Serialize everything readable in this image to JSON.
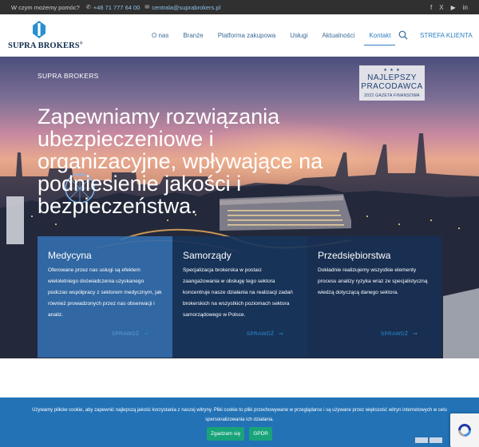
{
  "topbar": {
    "question": "W czym możemy pomóc?",
    "phone": "+48 71 777 64 00",
    "email": "centrala@suprabrokers.pl",
    "social": [
      "f",
      "X",
      "▶",
      "in"
    ]
  },
  "header": {
    "logo_text": "SUPRA BROKERS",
    "logo_reg": "®",
    "nav": [
      "O nas",
      "Branże",
      "Platforma zakupowa",
      "Usługi",
      "Aktualności",
      "Kontakt"
    ],
    "active_nav": "Kontakt",
    "strefa": "STREFA KLIENTA"
  },
  "hero": {
    "brand": "SUPRA BROKERS",
    "headline": "Zapewniamy rozwiązania ubezpieczeniowe i organizacyjne, wpływające na podniesienie jakości i bezpieczeństwa.",
    "award": {
      "line1": "NAJLEPSZY",
      "line2": "PRACODAWCA",
      "line3": "2022 GAZETA FINANSOWA"
    }
  },
  "cards": [
    {
      "title": "Medycyna",
      "text": "Oferowane przez nas usługi są efektem wieloletniego doświadczenia uzyskanego podczas współpracy z sektorem medycznym, jak również prowadzonych przez nas obserwacji i analiz.",
      "more": "SPRAWDŹ"
    },
    {
      "title": "Samorządy",
      "text": "Specjalizacja brokerska w postaci zaangażowania w obsługę tego sektora koncentruje nasze działania na realizacji zadań brokerskich na wszystkich poziomach sektora samorządowego w Polsce.",
      "more": "SPRAWDŹ"
    },
    {
      "title": "Przedsiębiorstwa",
      "text": "Dokładnie realizujemy wszystkie elementy procesu analizy ryzyka wraz ze specjalistyczną wiedzą dotyczącą danego sektora.",
      "more": "SPRAWDŹ"
    }
  ],
  "cookie": {
    "text": "Używamy plików cookie, aby zapewnić najlepszą jakość korzystania z naszej witryny. Pliki cookie to pliki przechowywane w przeglądarce i są używane przez większość witryn internetowych w celu spersonalizowania ich działania.",
    "accept": "Zgadzam się",
    "gdpr": "GPDR"
  },
  "colors": {
    "accent": "#2d7fc1",
    "topbar_bg": "#303030",
    "cookie_bg": "#2372b5",
    "accept_btn": "#19a37a"
  }
}
